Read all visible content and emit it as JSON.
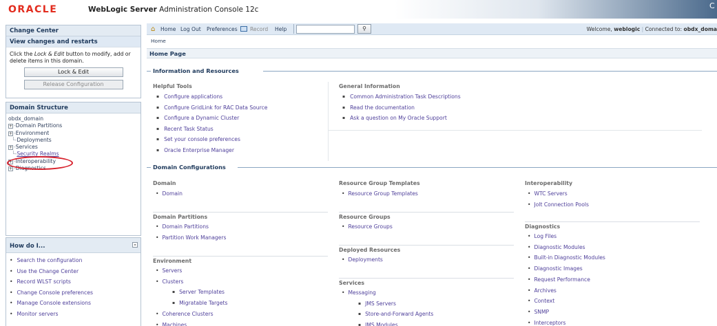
{
  "banner": {
    "logo": "ORACLE",
    "product_bold": "WebLogic Server",
    "product_rest": " Administration Console 12c",
    "corner": "C"
  },
  "change_center": {
    "title": "Change Center",
    "subtitle": "View changes and restarts",
    "desc_pre": "Click the ",
    "desc_em": "Lock & Edit",
    "desc_post": " button to modify, add or delete items in this domain.",
    "lock_button": "Lock & Edit",
    "release_button": "Release Configuration"
  },
  "domain_structure": {
    "title": "Domain Structure",
    "root": "obdx_domain",
    "items": [
      {
        "label": "Domain Partitions",
        "expandable": true
      },
      {
        "label": "Environment",
        "expandable": true
      },
      {
        "label": "Deployments",
        "expandable": false
      },
      {
        "label": "Services",
        "expandable": true
      },
      {
        "label": "Security Realms",
        "expandable": false
      },
      {
        "label": "Interoperability",
        "expandable": true
      },
      {
        "label": "Diagnostics",
        "expandable": true
      }
    ]
  },
  "how_do_i": {
    "title": "How do I...",
    "items": [
      "Search the configuration",
      "Use the Change Center",
      "Record WLST scripts",
      "Change Console preferences",
      "Manage Console extensions",
      "Monitor servers"
    ]
  },
  "toolbar": {
    "home": "Home",
    "logout": "Log Out",
    "preferences": "Preferences",
    "record": "Record",
    "help": "Help",
    "search_value": "",
    "welcome_label": "Welcome, ",
    "user": "weblogic",
    "connected_label": "Connected to: ",
    "domain": "obdx_doma"
  },
  "breadcrumb": "Home",
  "page_title": "Home Page",
  "info_resources": {
    "heading": "Information and Resources",
    "helpful_tools": {
      "title": "Helpful Tools",
      "items": [
        "Configure applications",
        "Configure GridLink for RAC Data Source",
        "Configure a Dynamic Cluster",
        "Recent Task Status",
        "Set your console preferences",
        "Oracle Enterprise Manager"
      ]
    },
    "general_info": {
      "title": "General Information",
      "items": [
        "Common Administration Task Descriptions",
        "Read the documentation",
        "Ask a question on My Oracle Support"
      ]
    }
  },
  "domain_config": {
    "heading": "Domain Configurations",
    "col1": {
      "domain": {
        "title": "Domain",
        "items": [
          "Domain"
        ]
      },
      "partitions": {
        "title": "Domain Partitions",
        "items": [
          "Domain Partitions",
          "Partition Work Managers"
        ]
      },
      "environment": {
        "title": "Environment",
        "items": [
          "Servers",
          "Clusters",
          "Server Templates",
          "Migratable Targets",
          "Coherence Clusters",
          "Machines"
        ]
      }
    },
    "col2": {
      "rgt": {
        "title": "Resource Group Templates",
        "items": [
          "Resource Group Templates"
        ]
      },
      "rg": {
        "title": "Resource Groups",
        "items": [
          "Resource Groups"
        ]
      },
      "deployed": {
        "title": "Deployed Resources",
        "items": [
          "Deployments"
        ]
      },
      "services": {
        "title": "Services",
        "items": [
          "Messaging",
          "JMS Servers",
          "Store-and-Forward Agents",
          "JMS Modules"
        ]
      }
    },
    "col3": {
      "interop": {
        "title": "Interoperability",
        "items": [
          "WTC Servers",
          "Jolt Connection Pools"
        ]
      },
      "diagnostics": {
        "title": "Diagnostics",
        "items": [
          "Log Files",
          "Diagnostic Modules",
          "Built-in Diagnostic Modules",
          "Diagnostic Images",
          "Request Performance",
          "Archives",
          "Context",
          "SNMP",
          "Interceptors"
        ]
      }
    }
  }
}
